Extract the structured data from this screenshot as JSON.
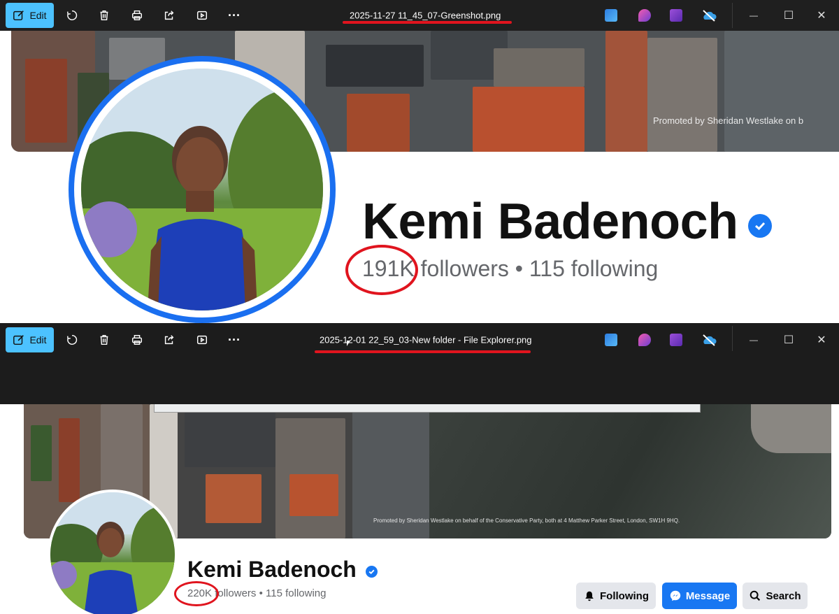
{
  "viewer_toolbar": {
    "edit_label": "Edit",
    "icons": [
      "enhance-icon",
      "delete-icon",
      "print-icon",
      "share-icon",
      "slideshow-icon",
      "more-icon"
    ],
    "app_icons": [
      "paint-icon",
      "clipchamp-icon",
      "designer-icon",
      "onedrive-icon"
    ],
    "window_controls": {
      "minimize": "—",
      "maximize": "☐",
      "close": "✕"
    }
  },
  "screenshot1": {
    "filename": "2025-11-27 11_45_07-Greenshot.png",
    "promo_text": "Promoted by Sheridan Westlake on b",
    "profile": {
      "name": "Kemi Badenoch",
      "followers": "191K",
      "followers_suffix": "followers",
      "separator": "•",
      "following": "115 following"
    }
  },
  "screenshot2": {
    "filename": "2025-12-01 22_59_03-New folder - File Explorer.png",
    "promo_text": "Promoted by Sheridan Westlake on behalf of the Conservative Party, both at 4 Matthew Parker Street, London, SW1H 9HQ.",
    "profile": {
      "name": "Kemi Badenoch",
      "followers": "220K",
      "followers_suffix": "followers",
      "separator": "•",
      "following": "115 following"
    },
    "buttons": {
      "following": "Following",
      "message": "Message",
      "search": "Search"
    }
  },
  "colors": {
    "toolbar_bg": "#1f1f1f",
    "edit_accent": "#4cc2ff",
    "annotation_red": "#e0141e",
    "facebook_blue": "#1877f2",
    "muted_text": "#65676b"
  }
}
